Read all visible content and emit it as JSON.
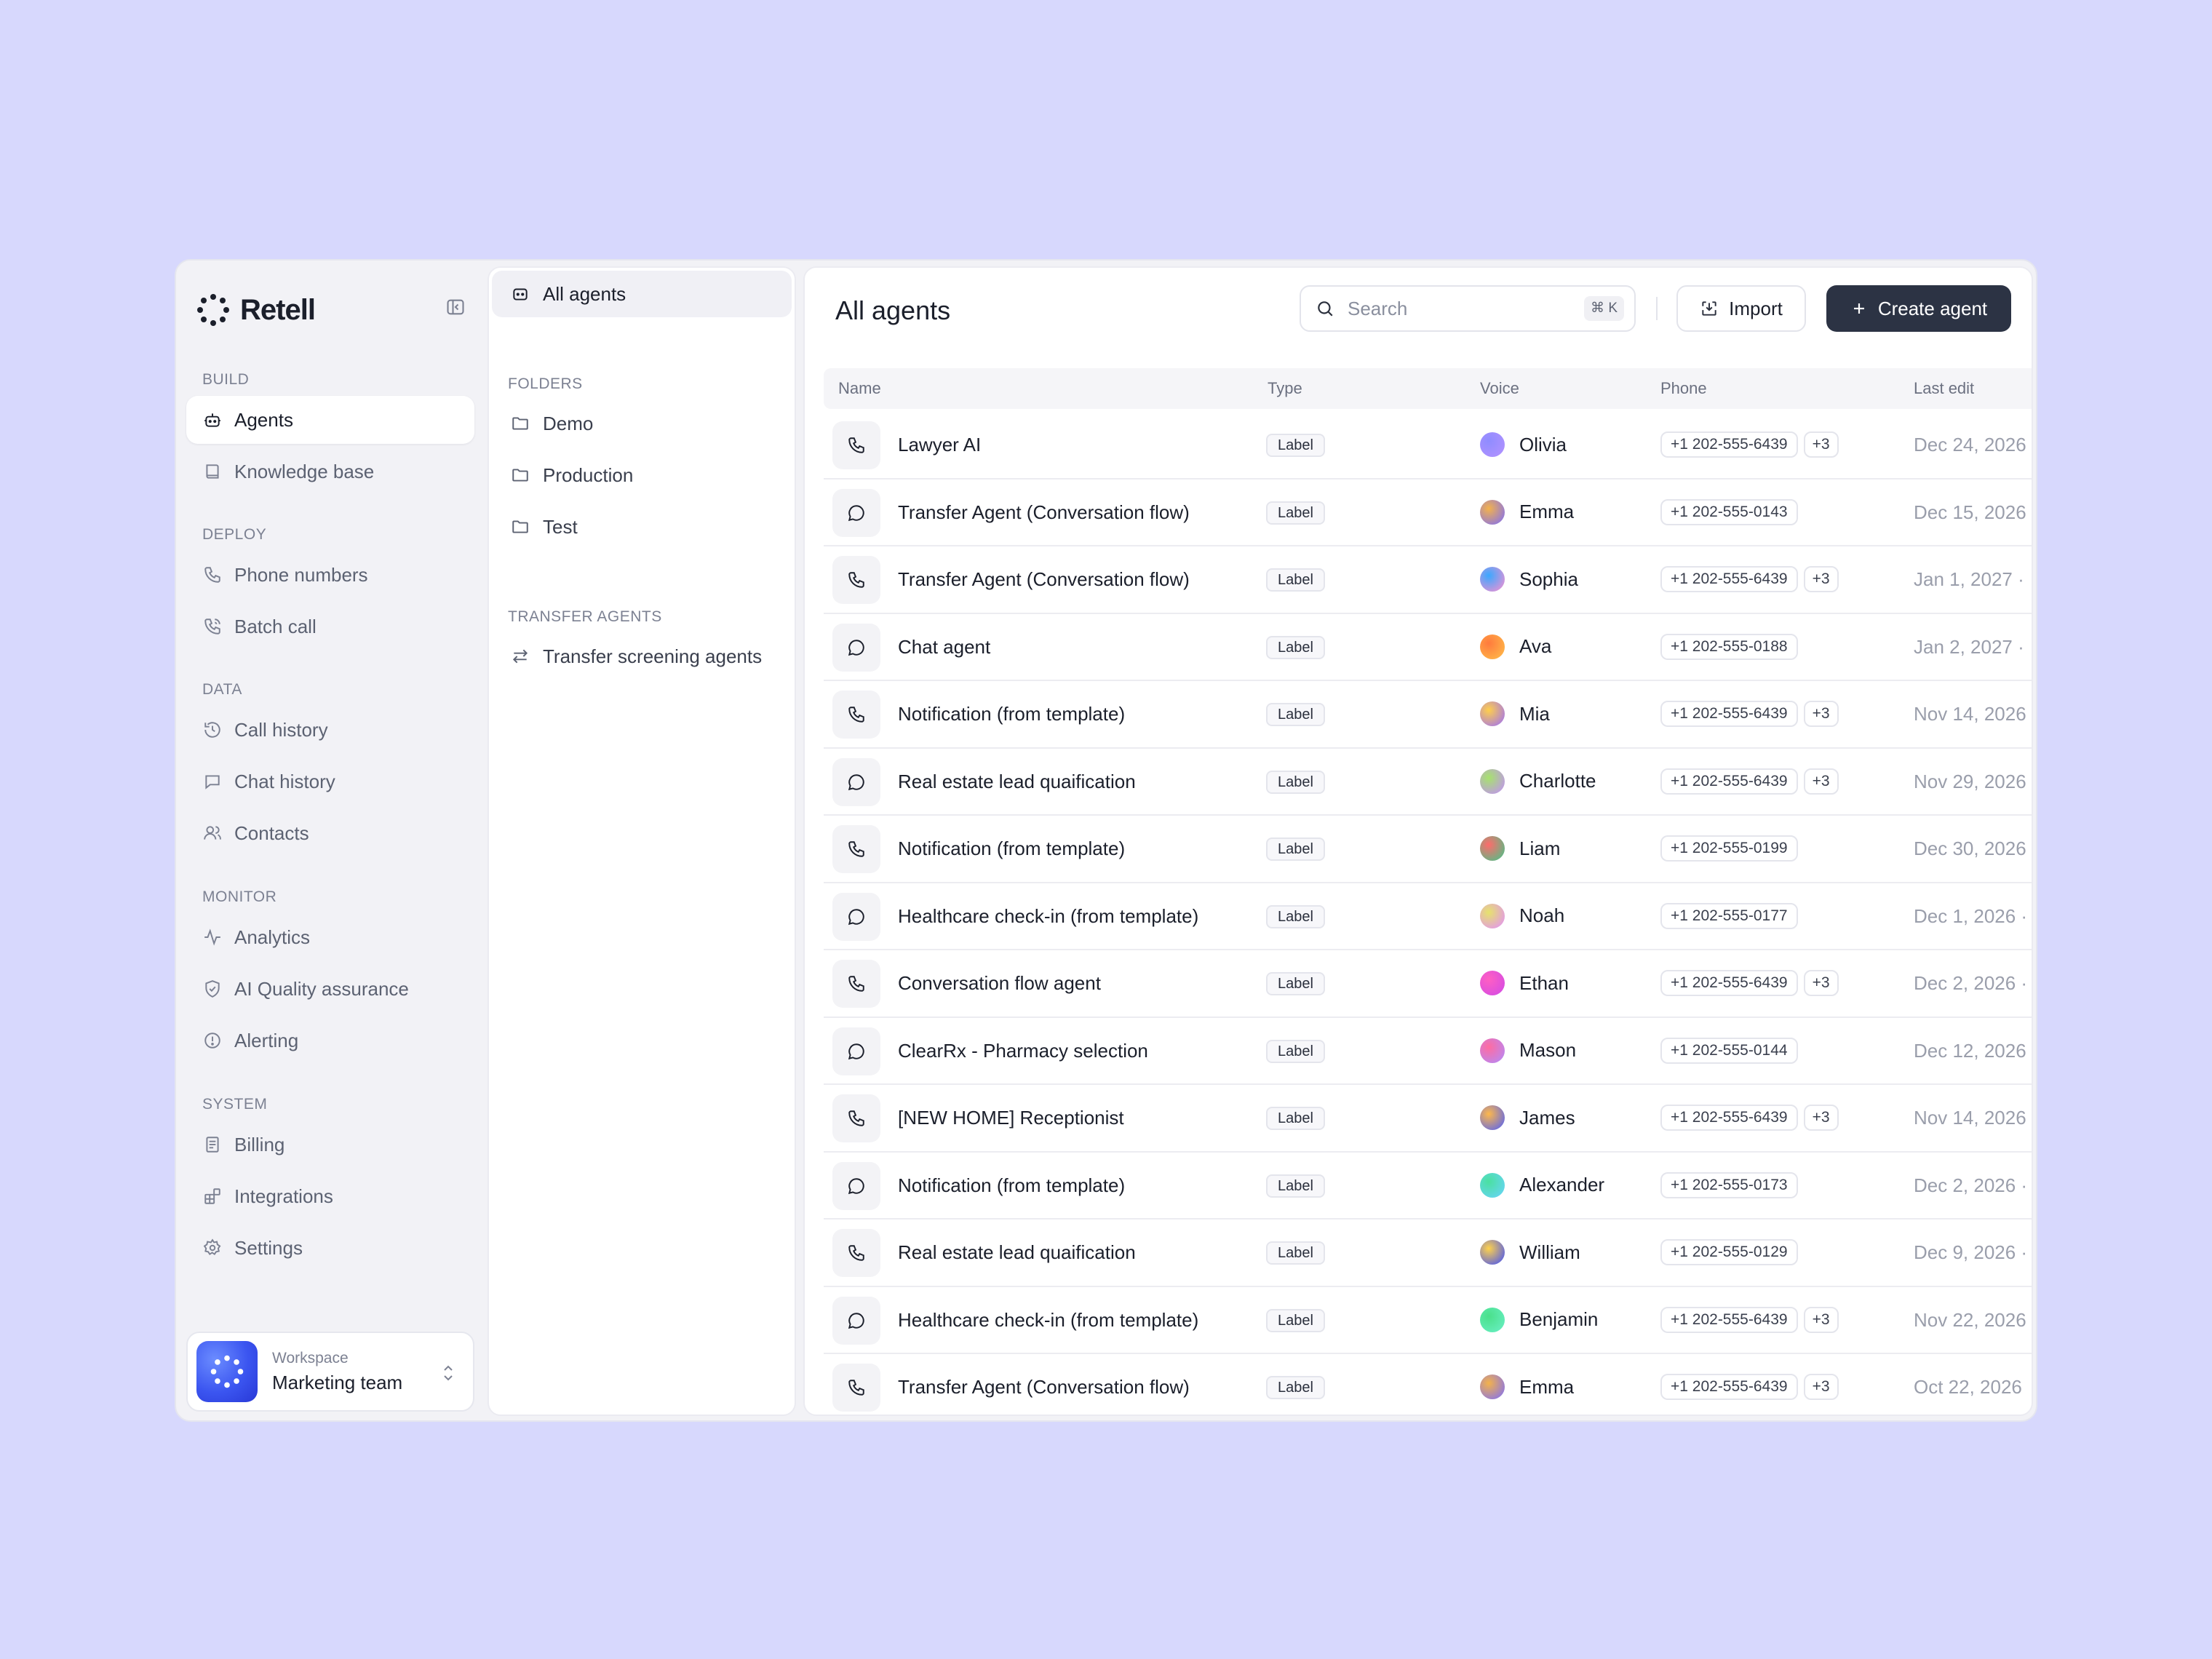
{
  "brand": {
    "name": "Retell"
  },
  "sidebar": {
    "sections": [
      {
        "label": "BUILD",
        "items": [
          {
            "label": "Agents",
            "icon": "bot-icon",
            "active": true
          },
          {
            "label": "Knowledge base",
            "icon": "book-icon"
          }
        ]
      },
      {
        "label": "DEPLOY",
        "items": [
          {
            "label": "Phone numbers",
            "icon": "phone-icon"
          },
          {
            "label": "Batch call",
            "icon": "phone-outgoing-icon"
          }
        ]
      },
      {
        "label": "DATA",
        "items": [
          {
            "label": "Call history",
            "icon": "history-icon"
          },
          {
            "label": "Chat history",
            "icon": "message-icon"
          },
          {
            "label": "Contacts",
            "icon": "users-icon"
          }
        ]
      },
      {
        "label": "MONITOR",
        "items": [
          {
            "label": "Analytics",
            "icon": "activity-icon"
          },
          {
            "label": "AI Quality assurance",
            "icon": "shield-check-icon"
          },
          {
            "label": "Alerting",
            "icon": "alert-circle-icon"
          }
        ]
      },
      {
        "label": "SYSTEM",
        "items": [
          {
            "label": "Billing",
            "icon": "receipt-icon"
          },
          {
            "label": "Integrations",
            "icon": "blocks-icon"
          },
          {
            "label": "Settings",
            "icon": "gear-icon"
          }
        ]
      }
    ],
    "workspace": {
      "label": "Workspace",
      "name": "Marketing team"
    }
  },
  "folders_panel": {
    "all_agents": "All agents",
    "folders_label": "FOLDERS",
    "folders": [
      "Demo",
      "Production",
      "Test"
    ],
    "transfer_label": "TRANSFER AGENTS",
    "transfer_items": [
      "Transfer screening agents"
    ]
  },
  "main": {
    "title": "All agents",
    "search": {
      "placeholder": "Search",
      "shortcut": "⌘ K"
    },
    "import_label": "Import",
    "create_label": "Create agent",
    "columns": {
      "name": "Name",
      "type": "Type",
      "voice": "Voice",
      "phone": "Phone",
      "last_edit": "Last edit"
    },
    "rows": [
      {
        "icon": "phone",
        "name": "Lawyer AI",
        "type": "Label",
        "voice": "Olivia",
        "voice_color": [
          "#8f8cff",
          "#b593ff"
        ],
        "phone": "+1 202-555-6439",
        "more": "+3",
        "date": "Dec 24, 2026"
      },
      {
        "icon": "chat",
        "name": "Transfer Agent (Conversation flow)",
        "type": "Label",
        "voice": "Emma",
        "voice_color": [
          "#f4b24a",
          "#7a6bff"
        ],
        "phone": "+1 202-555-0143",
        "more": "",
        "date": "Dec 15, 2026"
      },
      {
        "icon": "phone",
        "name": "Transfer Agent (Conversation flow)",
        "type": "Label",
        "voice": "Sophia",
        "voice_color": [
          "#3aa8ff",
          "#ff8fd0"
        ],
        "phone": "+1 202-555-6439",
        "more": "+3",
        "date": "Jan 1, 2027 ·"
      },
      {
        "icon": "chat",
        "name": "Chat agent",
        "type": "Label",
        "voice": "Ava",
        "voice_color": [
          "#ff7a3d",
          "#ffc04a"
        ],
        "phone": "+1 202-555-0188",
        "more": "",
        "date": "Jan 2, 2027 ·"
      },
      {
        "icon": "phone",
        "name": "Notification (from template)",
        "type": "Label",
        "voice": "Mia",
        "voice_color": [
          "#ffcf4a",
          "#9a6bff"
        ],
        "phone": "+1 202-555-6439",
        "more": "+3",
        "date": "Nov 14, 2026"
      },
      {
        "icon": "chat",
        "name": "Real estate lead quaification",
        "type": "Label",
        "voice": "Charlotte",
        "voice_color": [
          "#a6e36b",
          "#c58cff"
        ],
        "phone": "+1 202-555-6439",
        "more": "+3",
        "date": "Nov 29, 2026"
      },
      {
        "icon": "phone",
        "name": "Notification (from template)",
        "type": "Label",
        "voice": "Liam",
        "voice_color": [
          "#ff6b6b",
          "#3cc98a"
        ],
        "phone": "+1 202-555-0199",
        "more": "",
        "date": "Dec 30, 2026"
      },
      {
        "icon": "chat",
        "name": "Healthcare check-in (from template)",
        "type": "Label",
        "voice": "Noah",
        "voice_color": [
          "#e6e36b",
          "#e38cff"
        ],
        "phone": "+1 202-555-0177",
        "more": "",
        "date": "Dec 1, 2026 ·"
      },
      {
        "icon": "phone",
        "name": "Conversation flow agent",
        "type": "Label",
        "voice": "Ethan",
        "voice_color": [
          "#ff5fc2",
          "#d04ae8"
        ],
        "phone": "+1 202-555-6439",
        "more": "+3",
        "date": "Dec 2, 2026 ·"
      },
      {
        "icon": "chat",
        "name": "ClearRx - Pharmacy selection",
        "type": "Label",
        "voice": "Mason",
        "voice_color": [
          "#ff6ba0",
          "#b08cff"
        ],
        "phone": "+1 202-555-0144",
        "more": "",
        "date": "Dec 12, 2026"
      },
      {
        "icon": "phone",
        "name": "[NEW HOME] Receptionist",
        "type": "Label",
        "voice": "James",
        "voice_color": [
          "#ffb84a",
          "#4a5cff"
        ],
        "phone": "+1 202-555-6439",
        "more": "+3",
        "date": "Nov 14, 2026"
      },
      {
        "icon": "chat",
        "name": "Notification (from template)",
        "type": "Label",
        "voice": "Alexander",
        "voice_color": [
          "#4ae0a0",
          "#6bd4ff"
        ],
        "phone": "+1 202-555-0173",
        "more": "",
        "date": "Dec 2, 2026 ·"
      },
      {
        "icon": "phone",
        "name": "Real estate lead quaification",
        "type": "Label",
        "voice": "William",
        "voice_color": [
          "#ffd24a",
          "#3b4cff"
        ],
        "phone": "+1 202-555-0129",
        "more": "",
        "date": "Dec 9, 2026 ·"
      },
      {
        "icon": "chat",
        "name": "Healthcare check-in (from template)",
        "type": "Label",
        "voice": "Benjamin",
        "voice_color": [
          "#4ae08a",
          "#6bf0c8"
        ],
        "phone": "+1 202-555-6439",
        "more": "+3",
        "date": "Nov 22, 2026"
      },
      {
        "icon": "phone",
        "name": "Transfer Agent (Conversation flow)",
        "type": "Label",
        "voice": "Emma",
        "voice_color": [
          "#f4b24a",
          "#7a6bff"
        ],
        "phone": "+1 202-555-6439",
        "more": "+3",
        "date": "Oct 22, 2026"
      }
    ]
  }
}
